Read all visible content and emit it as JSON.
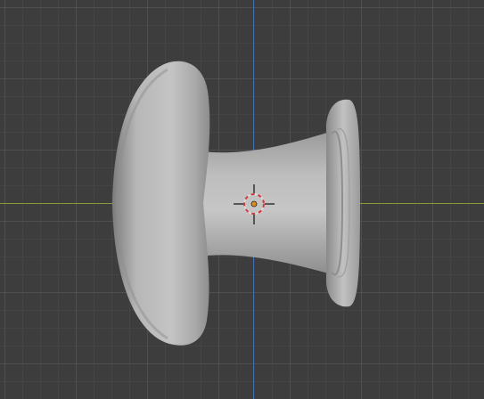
{
  "app": "3d-viewport",
  "viewport": {
    "background_color": "#3d3d3d",
    "grid_color": "#505050",
    "x_axis_color": "#8a9a3a",
    "y_axis_color": "#3f6fb0"
  },
  "object": {
    "name_semantic": "drawer-knob-mesh",
    "color": "#b8b8b8"
  },
  "cursor": {
    "ring_colors": [
      "#d9d9d9",
      "#d23a3a"
    ],
    "origin_color": "#e08a1e"
  }
}
